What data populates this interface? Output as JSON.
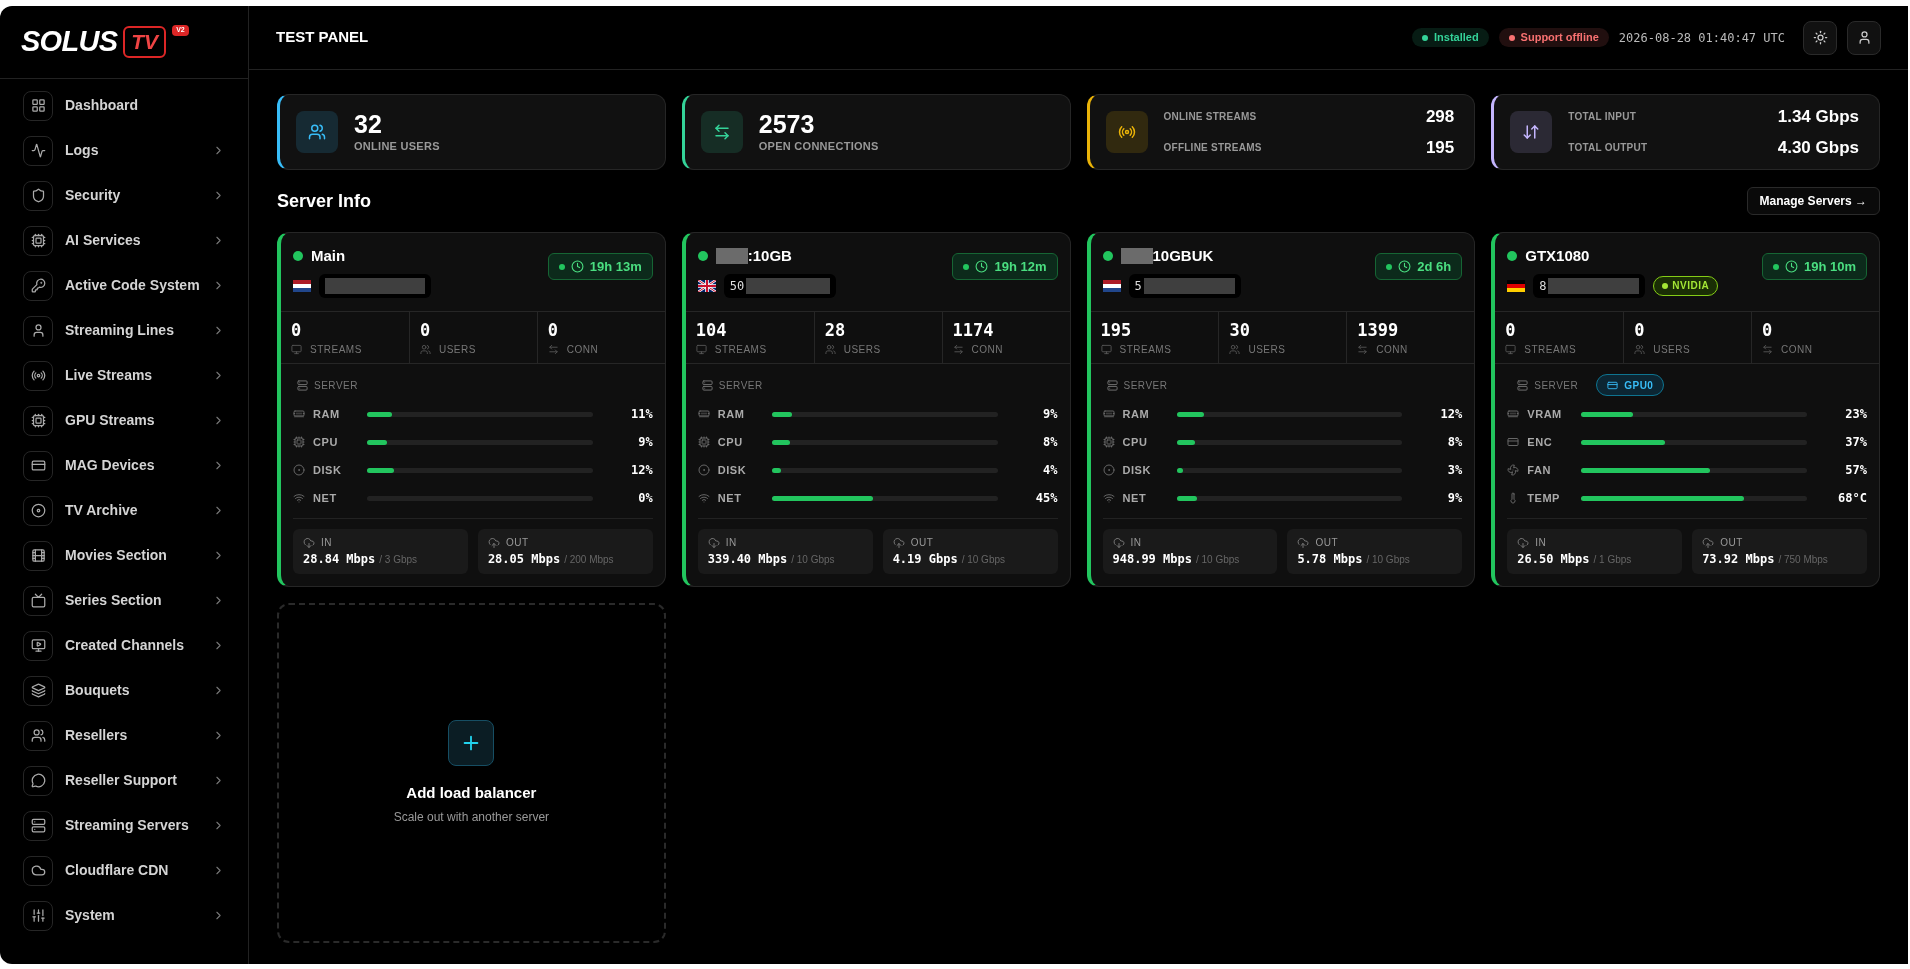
{
  "brand": {
    "name": "SOLUS",
    "mark": "TV",
    "version": "V2"
  },
  "sidebar": {
    "items": [
      {
        "label": "Dashboard",
        "has_submenu": false
      },
      {
        "label": "Logs",
        "has_submenu": true
      },
      {
        "label": "Security",
        "has_submenu": true
      },
      {
        "label": "AI Services",
        "has_submenu": true
      },
      {
        "label": "Active Code System",
        "has_submenu": true
      },
      {
        "label": "Streaming Lines",
        "has_submenu": true
      },
      {
        "label": "Live Streams",
        "has_submenu": true
      },
      {
        "label": "GPU Streams",
        "has_submenu": true
      },
      {
        "label": "MAG Devices",
        "has_submenu": true
      },
      {
        "label": "TV Archive",
        "has_submenu": true
      },
      {
        "label": "Movies Section",
        "has_submenu": true
      },
      {
        "label": "Series Section",
        "has_submenu": true
      },
      {
        "label": "Created Channels",
        "has_submenu": true
      },
      {
        "label": "Bouquets",
        "has_submenu": true
      },
      {
        "label": "Resellers",
        "has_submenu": true
      },
      {
        "label": "Reseller Support",
        "has_submenu": true
      },
      {
        "label": "Streaming Servers",
        "has_submenu": true
      },
      {
        "label": "Cloudflare CDN",
        "has_submenu": true
      },
      {
        "label": "System",
        "has_submenu": true
      }
    ]
  },
  "header": {
    "title": "TEST PANEL",
    "badges": [
      {
        "label": "Installed",
        "color": "#34d399"
      },
      {
        "label": "Support offline",
        "color": "#f87171"
      }
    ],
    "timestamp": "2026-08-28 01:40:47 UTC"
  },
  "summary_cards": [
    {
      "kind": "single",
      "color": "#38bdf8",
      "value": "32",
      "label": "ONLINE USERS"
    },
    {
      "kind": "single",
      "color": "#34d399",
      "value": "2573",
      "label": "OPEN CONNECTIONS"
    },
    {
      "kind": "pair",
      "color": "#eab308",
      "rows": [
        {
          "label": "ONLINE STREAMS",
          "value": "298"
        },
        {
          "label": "OFFLINE STREAMS",
          "value": "195"
        }
      ]
    },
    {
      "kind": "pair",
      "color": "#c4b5fd",
      "rows": [
        {
          "label": "TOTAL INPUT",
          "value": "1.34 Gbps"
        },
        {
          "label": "TOTAL OUTPUT",
          "value": "4.30 Gbps"
        }
      ]
    }
  ],
  "section": {
    "title": "Server Info",
    "action": "Manage Servers →"
  },
  "servers": [
    {
      "name": "Main",
      "name_masked": false,
      "uptime": "19h 13m",
      "stats": [
        {
          "value": "0",
          "label": "STREAMS"
        },
        {
          "value": "0",
          "label": "USERS"
        },
        {
          "value": "0",
          "label": "CONN"
        }
      ],
      "tabs": [
        {
          "label": "SERVER",
          "selected": true
        }
      ],
      "metrics": [
        {
          "kind": "ram",
          "label": "RAM",
          "level": 0.11,
          "value": "11%"
        },
        {
          "kind": "cpu",
          "label": "CPU",
          "level": 0.09,
          "value": "9%"
        },
        {
          "kind": "disk",
          "label": "DISK",
          "level": 0.12,
          "value": "12%"
        },
        {
          "kind": "net",
          "label": "NET",
          "level": 0,
          "value": "0%"
        }
      ],
      "in": {
        "label": "IN",
        "value": "28.84 Mbps",
        "limit": "/ 3 Gbps"
      },
      "out": {
        "label": "OUT",
        "value": "28.05 Mbps",
        "limit": "/ 200 Mbps"
      }
    },
    {
      "name": ":10GB",
      "name_masked": true,
      "ip": "50",
      "uptime": "19h 12m",
      "stats": [
        {
          "value": "104",
          "label": "STREAMS"
        },
        {
          "value": "28",
          "label": "USERS"
        },
        {
          "value": "1174",
          "label": "CONN"
        }
      ],
      "tabs": [
        {
          "label": "SERVER",
          "selected": true
        }
      ],
      "metrics": [
        {
          "kind": "ram",
          "label": "RAM",
          "level": 0.09,
          "value": "9%"
        },
        {
          "kind": "cpu",
          "label": "CPU",
          "level": 0.08,
          "value": "8%"
        },
        {
          "kind": "disk",
          "label": "DISK",
          "level": 0.04,
          "value": "4%"
        },
        {
          "kind": "net",
          "label": "NET",
          "level": 0.45,
          "value": "45%"
        }
      ],
      "in": {
        "label": "IN",
        "value": "339.40 Mbps",
        "limit": "/ 10 Gbps"
      },
      "out": {
        "label": "OUT",
        "value": "4.19 Gbps",
        "limit": "/ 10 Gbps"
      }
    },
    {
      "name": "10GBUK",
      "name_masked": true,
      "ip": "5",
      "uptime": "2d 6h",
      "stats": [
        {
          "value": "195",
          "label": "STREAMS"
        },
        {
          "value": "30",
          "label": "USERS"
        },
        {
          "value": "1399",
          "label": "CONN"
        }
      ],
      "tabs": [
        {
          "label": "SERVER",
          "selected": true
        }
      ],
      "metrics": [
        {
          "kind": "ram",
          "label": "RAM",
          "level": 0.12,
          "value": "12%"
        },
        {
          "kind": "cpu",
          "label": "CPU",
          "level": 0.08,
          "value": "8%"
        },
        {
          "kind": "disk",
          "label": "DISK",
          "level": 0.03,
          "value": "3%"
        },
        {
          "kind": "net",
          "label": "NET",
          "level": 0.09,
          "value": "9%"
        }
      ],
      "in": {
        "label": "IN",
        "value": "948.99 Mbps",
        "limit": "/ 10 Gbps"
      },
      "out": {
        "label": "OUT",
        "value": "5.78 Mbps",
        "limit": "/ 10 Gbps"
      }
    },
    {
      "name": "GTX1080",
      "name_masked": false,
      "ip": "8",
      "gpu_badge": "NVIDIA",
      "uptime": "19h 10m",
      "stats": [
        {
          "value": "0",
          "label": "STREAMS"
        },
        {
          "value": "0",
          "label": "USERS"
        },
        {
          "value": "0",
          "label": "CONN"
        }
      ],
      "tabs": [
        {
          "label": "SERVER",
          "selected": false
        },
        {
          "label": "GPU0",
          "selected": true
        }
      ],
      "metrics": [
        {
          "kind": "vram",
          "label": "VRAM",
          "level": 0.23,
          "value": "23%"
        },
        {
          "kind": "enc",
          "label": "ENC",
          "level": 0.37,
          "value": "37%"
        },
        {
          "kind": "fan",
          "label": "FAN",
          "level": 0.57,
          "value": "57%"
        },
        {
          "kind": "temp",
          "label": "TEMP",
          "level": 0.72,
          "value": "68°C"
        }
      ],
      "in": {
        "label": "IN",
        "value": "26.50 Mbps",
        "limit": "/ 1 Gbps"
      },
      "out": {
        "label": "OUT",
        "value": "73.92 Mbps",
        "limit": "/ 750 Mbps"
      }
    }
  ],
  "add_card": {
    "title": "Add load balancer",
    "subtitle": "Scale out with another server"
  }
}
